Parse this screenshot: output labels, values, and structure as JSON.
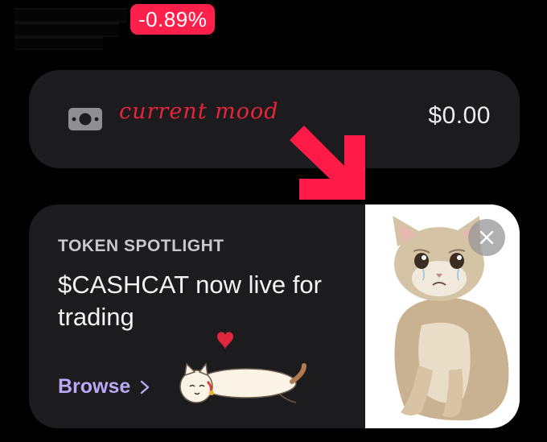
{
  "header": {
    "change_badge": "-0.89%"
  },
  "balance_card": {
    "icon": "money-bill-icon",
    "mood_text": "current mood",
    "balance": "$0.00"
  },
  "spotlight": {
    "label": "TOKEN SPOTLIGHT",
    "title": "$CASHCAT now live for trading",
    "browse_label": "Browse",
    "image": "crying-cat-photo",
    "close_icon": "close-icon"
  },
  "colors": {
    "badge_bg": "#ff1f4b",
    "mood_red": "#e8243c",
    "arrow_red": "#ff1a47",
    "browse_purple": "#b9a8f5",
    "card_bg": "#1c1c1e"
  }
}
